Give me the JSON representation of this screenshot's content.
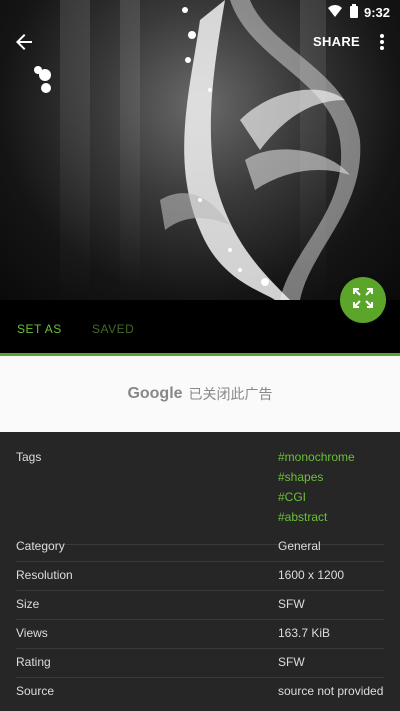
{
  "status_bar": {
    "time": "9:32"
  },
  "app_bar": {
    "share_label": "SHARE"
  },
  "actions": {
    "set_as_label": "SET AS",
    "saved_label": "SAVED"
  },
  "ad": {
    "brand": "Google",
    "text": "已关闭此广告"
  },
  "details": {
    "tags_label": "Tags",
    "tags": [
      "#monochrome",
      "#shapes",
      "#CGI",
      "#abstract"
    ],
    "rows": [
      {
        "label": "Category",
        "value": "General"
      },
      {
        "label": "Resolution",
        "value": "1600 x 1200"
      },
      {
        "label": "Size",
        "value": "SFW"
      },
      {
        "label": "Views",
        "value": "163.7 KiB"
      },
      {
        "label": "Rating",
        "value": "SFW"
      },
      {
        "label": "Source",
        "value": "source not provided"
      }
    ]
  },
  "colors": {
    "accent": "#5ba52a",
    "tag": "#6bbf38",
    "saved": "#3f6a27"
  }
}
